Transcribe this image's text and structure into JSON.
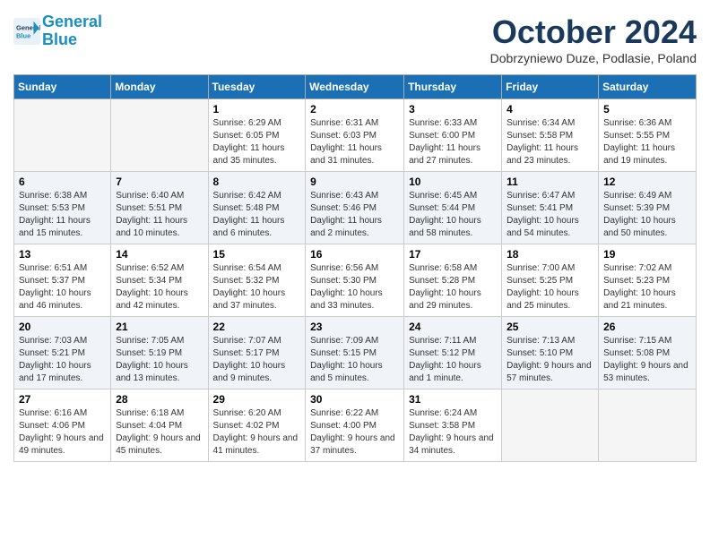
{
  "header": {
    "logo_line1": "General",
    "logo_line2": "Blue",
    "month": "October 2024",
    "location": "Dobrzyniewo Duze, Podlasie, Poland"
  },
  "weekdays": [
    "Sunday",
    "Monday",
    "Tuesday",
    "Wednesday",
    "Thursday",
    "Friday",
    "Saturday"
  ],
  "weeks": [
    [
      {
        "day": "",
        "info": ""
      },
      {
        "day": "",
        "info": ""
      },
      {
        "day": "1",
        "info": "Sunrise: 6:29 AM\nSunset: 6:05 PM\nDaylight: 11 hours and 35 minutes."
      },
      {
        "day": "2",
        "info": "Sunrise: 6:31 AM\nSunset: 6:03 PM\nDaylight: 11 hours and 31 minutes."
      },
      {
        "day": "3",
        "info": "Sunrise: 6:33 AM\nSunset: 6:00 PM\nDaylight: 11 hours and 27 minutes."
      },
      {
        "day": "4",
        "info": "Sunrise: 6:34 AM\nSunset: 5:58 PM\nDaylight: 11 hours and 23 minutes."
      },
      {
        "day": "5",
        "info": "Sunrise: 6:36 AM\nSunset: 5:55 PM\nDaylight: 11 hours and 19 minutes."
      }
    ],
    [
      {
        "day": "6",
        "info": "Sunrise: 6:38 AM\nSunset: 5:53 PM\nDaylight: 11 hours and 15 minutes."
      },
      {
        "day": "7",
        "info": "Sunrise: 6:40 AM\nSunset: 5:51 PM\nDaylight: 11 hours and 10 minutes."
      },
      {
        "day": "8",
        "info": "Sunrise: 6:42 AM\nSunset: 5:48 PM\nDaylight: 11 hours and 6 minutes."
      },
      {
        "day": "9",
        "info": "Sunrise: 6:43 AM\nSunset: 5:46 PM\nDaylight: 11 hours and 2 minutes."
      },
      {
        "day": "10",
        "info": "Sunrise: 6:45 AM\nSunset: 5:44 PM\nDaylight: 10 hours and 58 minutes."
      },
      {
        "day": "11",
        "info": "Sunrise: 6:47 AM\nSunset: 5:41 PM\nDaylight: 10 hours and 54 minutes."
      },
      {
        "day": "12",
        "info": "Sunrise: 6:49 AM\nSunset: 5:39 PM\nDaylight: 10 hours and 50 minutes."
      }
    ],
    [
      {
        "day": "13",
        "info": "Sunrise: 6:51 AM\nSunset: 5:37 PM\nDaylight: 10 hours and 46 minutes."
      },
      {
        "day": "14",
        "info": "Sunrise: 6:52 AM\nSunset: 5:34 PM\nDaylight: 10 hours and 42 minutes."
      },
      {
        "day": "15",
        "info": "Sunrise: 6:54 AM\nSunset: 5:32 PM\nDaylight: 10 hours and 37 minutes."
      },
      {
        "day": "16",
        "info": "Sunrise: 6:56 AM\nSunset: 5:30 PM\nDaylight: 10 hours and 33 minutes."
      },
      {
        "day": "17",
        "info": "Sunrise: 6:58 AM\nSunset: 5:28 PM\nDaylight: 10 hours and 29 minutes."
      },
      {
        "day": "18",
        "info": "Sunrise: 7:00 AM\nSunset: 5:25 PM\nDaylight: 10 hours and 25 minutes."
      },
      {
        "day": "19",
        "info": "Sunrise: 7:02 AM\nSunset: 5:23 PM\nDaylight: 10 hours and 21 minutes."
      }
    ],
    [
      {
        "day": "20",
        "info": "Sunrise: 7:03 AM\nSunset: 5:21 PM\nDaylight: 10 hours and 17 minutes."
      },
      {
        "day": "21",
        "info": "Sunrise: 7:05 AM\nSunset: 5:19 PM\nDaylight: 10 hours and 13 minutes."
      },
      {
        "day": "22",
        "info": "Sunrise: 7:07 AM\nSunset: 5:17 PM\nDaylight: 10 hours and 9 minutes."
      },
      {
        "day": "23",
        "info": "Sunrise: 7:09 AM\nSunset: 5:15 PM\nDaylight: 10 hours and 5 minutes."
      },
      {
        "day": "24",
        "info": "Sunrise: 7:11 AM\nSunset: 5:12 PM\nDaylight: 10 hours and 1 minute."
      },
      {
        "day": "25",
        "info": "Sunrise: 7:13 AM\nSunset: 5:10 PM\nDaylight: 9 hours and 57 minutes."
      },
      {
        "day": "26",
        "info": "Sunrise: 7:15 AM\nSunset: 5:08 PM\nDaylight: 9 hours and 53 minutes."
      }
    ],
    [
      {
        "day": "27",
        "info": "Sunrise: 6:16 AM\nSunset: 4:06 PM\nDaylight: 9 hours and 49 minutes."
      },
      {
        "day": "28",
        "info": "Sunrise: 6:18 AM\nSunset: 4:04 PM\nDaylight: 9 hours and 45 minutes."
      },
      {
        "day": "29",
        "info": "Sunrise: 6:20 AM\nSunset: 4:02 PM\nDaylight: 9 hours and 41 minutes."
      },
      {
        "day": "30",
        "info": "Sunrise: 6:22 AM\nSunset: 4:00 PM\nDaylight: 9 hours and 37 minutes."
      },
      {
        "day": "31",
        "info": "Sunrise: 6:24 AM\nSunset: 3:58 PM\nDaylight: 9 hours and 34 minutes."
      },
      {
        "day": "",
        "info": ""
      },
      {
        "day": "",
        "info": ""
      }
    ]
  ]
}
